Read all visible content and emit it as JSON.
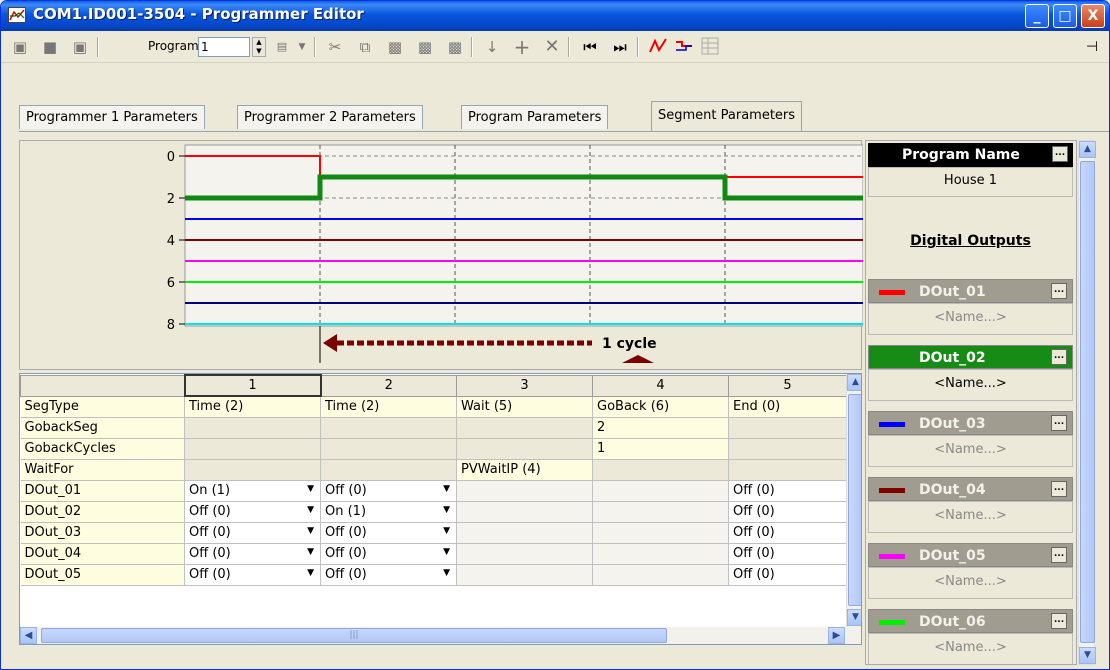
{
  "window": {
    "title": "COM1.ID001-3504 - Programmer Editor"
  },
  "caption_buttons": {
    "minimize": "_",
    "maximize": "□",
    "close": "X"
  },
  "toolbar": {
    "program_label": "Program:",
    "program_value": "1",
    "pin_glyph": "⊣"
  },
  "tabs": [
    {
      "label": "Programmer 1 Parameters"
    },
    {
      "label": "Programmer 2 Parameters"
    },
    {
      "label": "Program Parameters"
    },
    {
      "label": "Segment Parameters"
    }
  ],
  "chart": {
    "yticks": [
      "0",
      "2",
      "4",
      "6",
      "8"
    ],
    "cycle_label": "1 cycle"
  },
  "chart_data": {
    "type": "line",
    "segment_boundaries": [
      1,
      2,
      3,
      4,
      5
    ],
    "ylim": [
      0,
      8
    ],
    "ytick_labels": [
      "0",
      "2",
      "4",
      "6",
      "8"
    ],
    "goback": {
      "from_segment": 4,
      "to_segment": 2,
      "cycles": 1
    },
    "series": [
      {
        "color": "#ff0000",
        "steps": [
          [
            0,
            0
          ],
          [
            1,
            1
          ]
        ]
      },
      {
        "color": "#118811",
        "steps": [
          [
            0,
            2
          ],
          [
            1,
            1
          ],
          [
            4,
            2
          ]
        ]
      },
      {
        "color": "#0000ff",
        "steps": [
          [
            0,
            3
          ]
        ]
      },
      {
        "color": "#800000",
        "steps": [
          [
            0,
            4
          ]
        ]
      },
      {
        "color": "#ff00ff",
        "steps": [
          [
            0,
            5
          ]
        ]
      },
      {
        "color": "#00ee00",
        "steps": [
          [
            0,
            6
          ]
        ]
      },
      {
        "color": "#000080",
        "steps": [
          [
            0,
            7
          ]
        ]
      },
      {
        "color": "#00e5e5",
        "steps": [
          [
            0,
            8
          ]
        ]
      }
    ]
  },
  "grid": {
    "columns": [
      "",
      "1",
      "2",
      "3",
      "4",
      "5"
    ],
    "rows": [
      {
        "label": "SegType",
        "cells": [
          "Time (2)",
          "Time (2)",
          "Wait (5)",
          "GoBack (6)",
          "End (0)"
        ]
      },
      {
        "label": "GobackSeg",
        "cells": [
          "",
          "",
          "",
          "2",
          ""
        ]
      },
      {
        "label": "GobackCycles",
        "cells": [
          "",
          "",
          "",
          "1",
          ""
        ]
      },
      {
        "label": "WaitFor",
        "cells": [
          "",
          "",
          "PVWaitIP (4)",
          "",
          ""
        ]
      },
      {
        "label": "DOut_01",
        "cells": [
          "On (1)",
          "Off (0)",
          "",
          "",
          "Off (0)"
        ]
      },
      {
        "label": "DOut_02",
        "cells": [
          "Off (0)",
          "On (1)",
          "",
          "",
          "Off (0)"
        ]
      },
      {
        "label": "DOut_03",
        "cells": [
          "Off (0)",
          "Off (0)",
          "",
          "",
          "Off (0)"
        ]
      },
      {
        "label": "DOut_04",
        "cells": [
          "Off (0)",
          "Off (0)",
          "",
          "",
          "Off (0)"
        ]
      },
      {
        "label": "DOut_05",
        "cells": [
          "Off (0)",
          "Off (0)",
          "",
          "",
          "Off (0)"
        ]
      }
    ]
  },
  "right_panel": {
    "program_name_label": "Program Name",
    "program_name_value": "House 1",
    "digital_outputs_title": "Digital Outputs",
    "ellipsis": "...",
    "douts": [
      {
        "label": "DOut_01",
        "name": "<Name...>",
        "color": "#ff0000"
      },
      {
        "label": "DOut_02",
        "name": "<Name...>",
        "color": "#118811"
      },
      {
        "label": "DOut_03",
        "name": "<Name...>",
        "color": "#0000ff"
      },
      {
        "label": "DOut_04",
        "name": "<Name...>",
        "color": "#800000"
      },
      {
        "label": "DOut_05",
        "name": "<Name...>",
        "color": "#ff00ff"
      },
      {
        "label": "DOut_06",
        "name": "<Name...>",
        "color": "#00ee00"
      }
    ]
  }
}
